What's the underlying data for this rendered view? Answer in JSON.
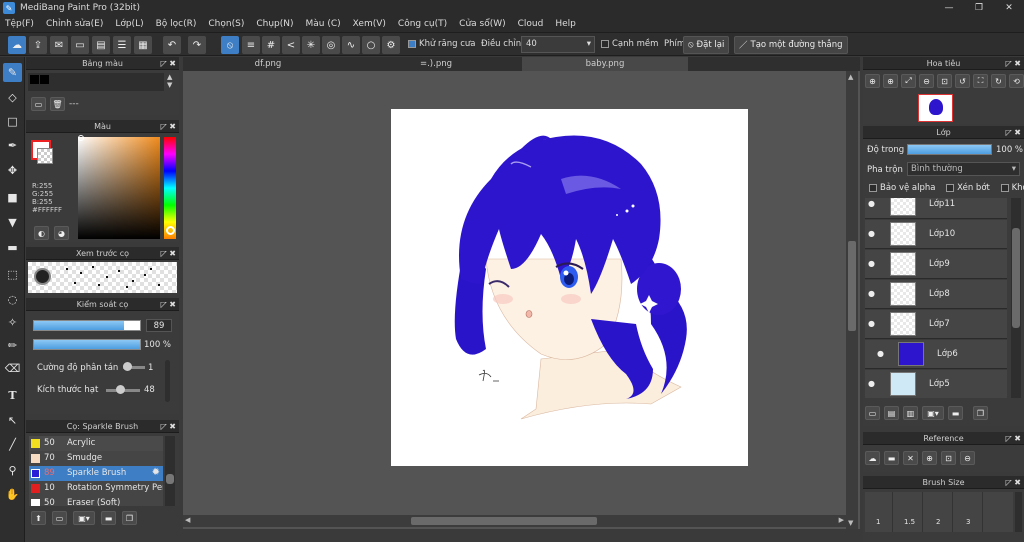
{
  "window": {
    "title": "MediBang Paint Pro (32bit)",
    "minimize": "—",
    "maximize": "❐",
    "close": "✕"
  },
  "menu": [
    "Tệp(F)",
    "Chỉnh sửa(E)",
    "Lớp(L)",
    "Bộ lọc(R)",
    "Chọn(S)",
    "Chụp(N)",
    "Màu (C)",
    "Xem(V)",
    "Công cụ(T)",
    "Cửa sổ(W)",
    "Cloud",
    "Help"
  ],
  "toolbar": {
    "antialias_label": "Khử răng cưa",
    "adjust_label": "Điều chỉnh",
    "adjust_value": "40",
    "edge_label": "Cạnh mềm",
    "key_label": "Phím",
    "reset_label": "Đặt lại",
    "line_label": "Tạo một đường thẳng"
  },
  "palette_panel": {
    "title": "Bảng màu",
    "dash": "---"
  },
  "color_panel": {
    "title": "Màu",
    "r": "R:255",
    "g": "G:255",
    "b": "B:255",
    "hex": "#FFFFFF",
    "primary": "#ffffff",
    "secondary": "#2a1fd6"
  },
  "preview_panel": {
    "title": "Xem trước cọ"
  },
  "brush_control": {
    "title": "Kiểm soát cọ",
    "size_value": "89",
    "opacity_value": "100 %",
    "scatter_label": "Cường độ phân tán",
    "scatter_value": "1",
    "particle_label": "Kích thước hạt",
    "particle_value": "48"
  },
  "brush_list": {
    "title": "Cọ: Sparkle Brush",
    "items": [
      {
        "size": "50",
        "name": "Acrylic",
        "color": "#f2e020"
      },
      {
        "size": "70",
        "name": "Smudge",
        "color": "#f7dcc4"
      },
      {
        "size": "89",
        "name": "Sparkle Brush",
        "color": "#2a1fd6"
      },
      {
        "size": "10",
        "name": "Rotation Symmetry Pen",
        "color": "#e02020"
      },
      {
        "size": "50",
        "name": "Eraser (Soft)",
        "color": "#ffffff"
      }
    ]
  },
  "tabs": [
    "df.png",
    "=.).png",
    "baby.png"
  ],
  "navigator": {
    "title": "Hoa tiêu"
  },
  "layer_panel": {
    "title": "Lớp",
    "opacity_label": "Độ trong",
    "opacity_value": "100 %",
    "blend_label": "Pha trộn",
    "blend_value": "Bình thường",
    "protect_alpha": "Bảo vệ alpha",
    "clipping": "Xén bớt",
    "lock": "Khóa",
    "layers": [
      "Lớp11",
      "Lớp10",
      "Lớp9",
      "Lớp8",
      "Lớp7",
      "Lớp6",
      "Lớp5"
    ]
  },
  "reference_panel": {
    "title": "Reference"
  },
  "brush_size_panel": {
    "title": "Brush Size",
    "sizes": [
      "1",
      "1.5",
      "2",
      "3"
    ]
  },
  "icons": {
    "eye": "●",
    "pin": "◸",
    "close": "✖",
    "dropdown": "▾"
  }
}
